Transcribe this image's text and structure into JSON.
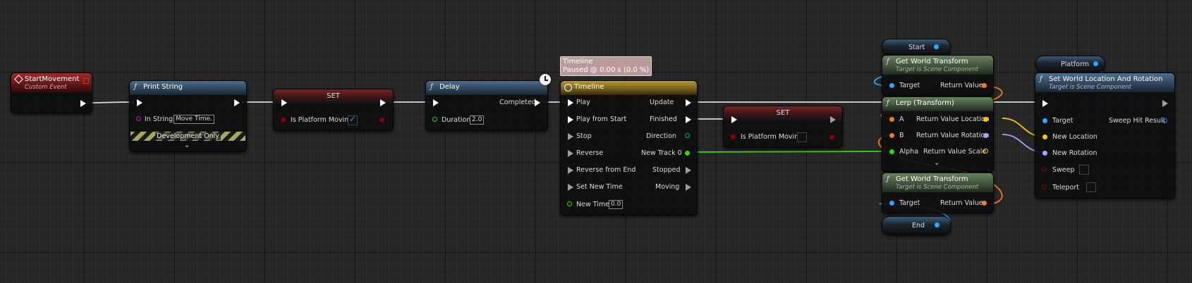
{
  "nodes": {
    "start_movement": {
      "title": "StartMovement",
      "subtitle": "Custom Event"
    },
    "print_string": {
      "title": "Print String",
      "in_string_label": "In String",
      "in_string_value": "Move Time.",
      "dev_only": "Development Only"
    },
    "set1": {
      "title": "SET",
      "pin_label": "Is Platform Moving",
      "checked": true
    },
    "delay": {
      "title": "Delay",
      "completed_label": "Completed",
      "duration_label": "Duration",
      "duration_value": "2.0"
    },
    "timeline": {
      "tooltip_line1": "Timeline",
      "tooltip_line2": "Paused @ 0.00 s (0.0 %)",
      "title": "Timeline",
      "inputs": [
        "Play",
        "Play from Start",
        "Stop",
        "Reverse",
        "Reverse from End",
        "Set New Time",
        "New Time"
      ],
      "new_time_value": "0.0",
      "outputs": [
        "Update",
        "Finished",
        "Direction",
        "New Track 0",
        "Stopped",
        "Moving"
      ]
    },
    "set2": {
      "title": "SET",
      "pin_label": "Is Platform Moving",
      "checked": false
    },
    "start_var": {
      "label": "Start"
    },
    "gwt1": {
      "title": "Get World Transform",
      "subtitle": "Target is Scene Component",
      "target_label": "Target",
      "return_label": "Return Value"
    },
    "lerp": {
      "title": "Lerp (Transform)",
      "a_label": "A",
      "b_label": "B",
      "alpha_label": "Alpha",
      "out_location": "Return Value Location",
      "out_rotation": "Return Value Rotation",
      "out_scale": "Return Value Scale"
    },
    "gwt2": {
      "title": "Get World Transform",
      "subtitle": "Target is Scene Component",
      "target_label": "Target",
      "return_label": "Return Value"
    },
    "end_var": {
      "label": "End"
    },
    "platform_var": {
      "label": "Platform"
    },
    "set_loc_rot": {
      "title": "Set World Location And Rotation",
      "subtitle": "Target is Scene Component",
      "target_label": "Target",
      "sweep_hit_label": "Sweep Hit Result",
      "new_location_label": "New Location",
      "new_rotation_label": "New Rotation",
      "sweep_label": "Sweep",
      "teleport_label": "Teleport"
    }
  },
  "colors": {
    "exec": "#ffffff",
    "bool": "#8c0000",
    "float": "#38d500",
    "string": "#f000d0",
    "object": "#29a8ff",
    "transform": "#f07a25",
    "vector": "#f7c615",
    "rotator": "#a3a6f7",
    "struct": "#f2f2f2"
  }
}
